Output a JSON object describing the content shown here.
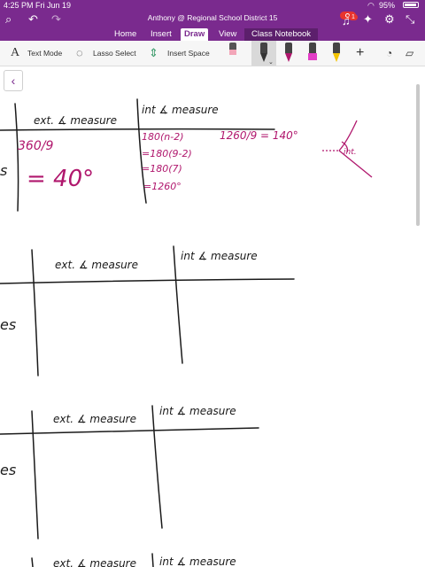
{
  "status_bar": {
    "time": "4:25 PM",
    "date": "Fri Jun 19",
    "battery": "95%"
  },
  "title_bar": {
    "title": "Anthony @ Regional School District 15",
    "notification_count": "1"
  },
  "tabs": [
    "Home",
    "Insert",
    "Draw",
    "View",
    "Class Notebook"
  ],
  "active_tab": "Draw",
  "ribbon": {
    "text_mode": "Text Mode",
    "lasso_select": "Lasso Select",
    "insert_space": "Insert Space"
  },
  "colors": {
    "accent": "#7a2a8e",
    "ink": "#1a1a1a",
    "magenta_ink": "#b0176d"
  },
  "notes": {
    "table_1": {
      "header_ext": "ext. ∡ measure",
      "header_int": "int ∡ measure",
      "row_label": "s",
      "ext_calc": "360/9",
      "ext_result": "= 40°",
      "int_lines": [
        "180(n-2)",
        "=180(9-2)",
        "=180(7)",
        "=1260°"
      ],
      "side_calc": "1260/9 = 140°",
      "diagram_label": "int."
    },
    "table_2": {
      "header_ext": "ext. ∡ measure",
      "header_int": "int ∡ measure",
      "row_label": "es"
    },
    "table_3": {
      "header_ext": "ext. ∡ measure",
      "header_int": "int ∡ measure",
      "row_label": "es"
    },
    "table_4": {
      "header_ext": "ext. ∡ measure",
      "header_int": "int ∡ measure"
    }
  }
}
